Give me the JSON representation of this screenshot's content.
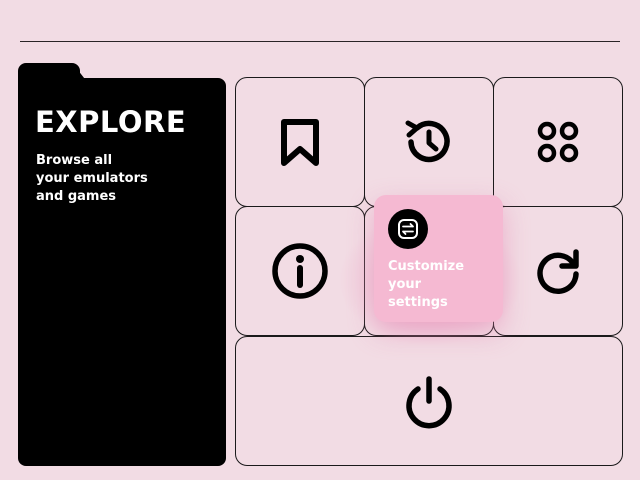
{
  "explore": {
    "title": "EXPLORE",
    "description": "Browse all\nyour emulators\nand games"
  },
  "tiles": [
    {
      "id": "bookmark",
      "icon": "bookmark-icon"
    },
    {
      "id": "history",
      "icon": "history-icon"
    },
    {
      "id": "apps",
      "icon": "grid-icon"
    },
    {
      "id": "info",
      "icon": "info-icon"
    },
    {
      "id": "settings",
      "icon": "toggle-settings-icon",
      "label": "Customize\nyour\nsettings"
    },
    {
      "id": "reload",
      "icon": "reload-icon"
    },
    {
      "id": "power",
      "icon": "power-icon"
    }
  ],
  "settings_card": {
    "label": "Customize\nyour\nsettings",
    "icon": "toggle-settings-icon"
  },
  "colors": {
    "background": "#f2dce4",
    "panel": "#000000",
    "accent": "#f5b9d2",
    "stroke": "#1b1a1b"
  }
}
